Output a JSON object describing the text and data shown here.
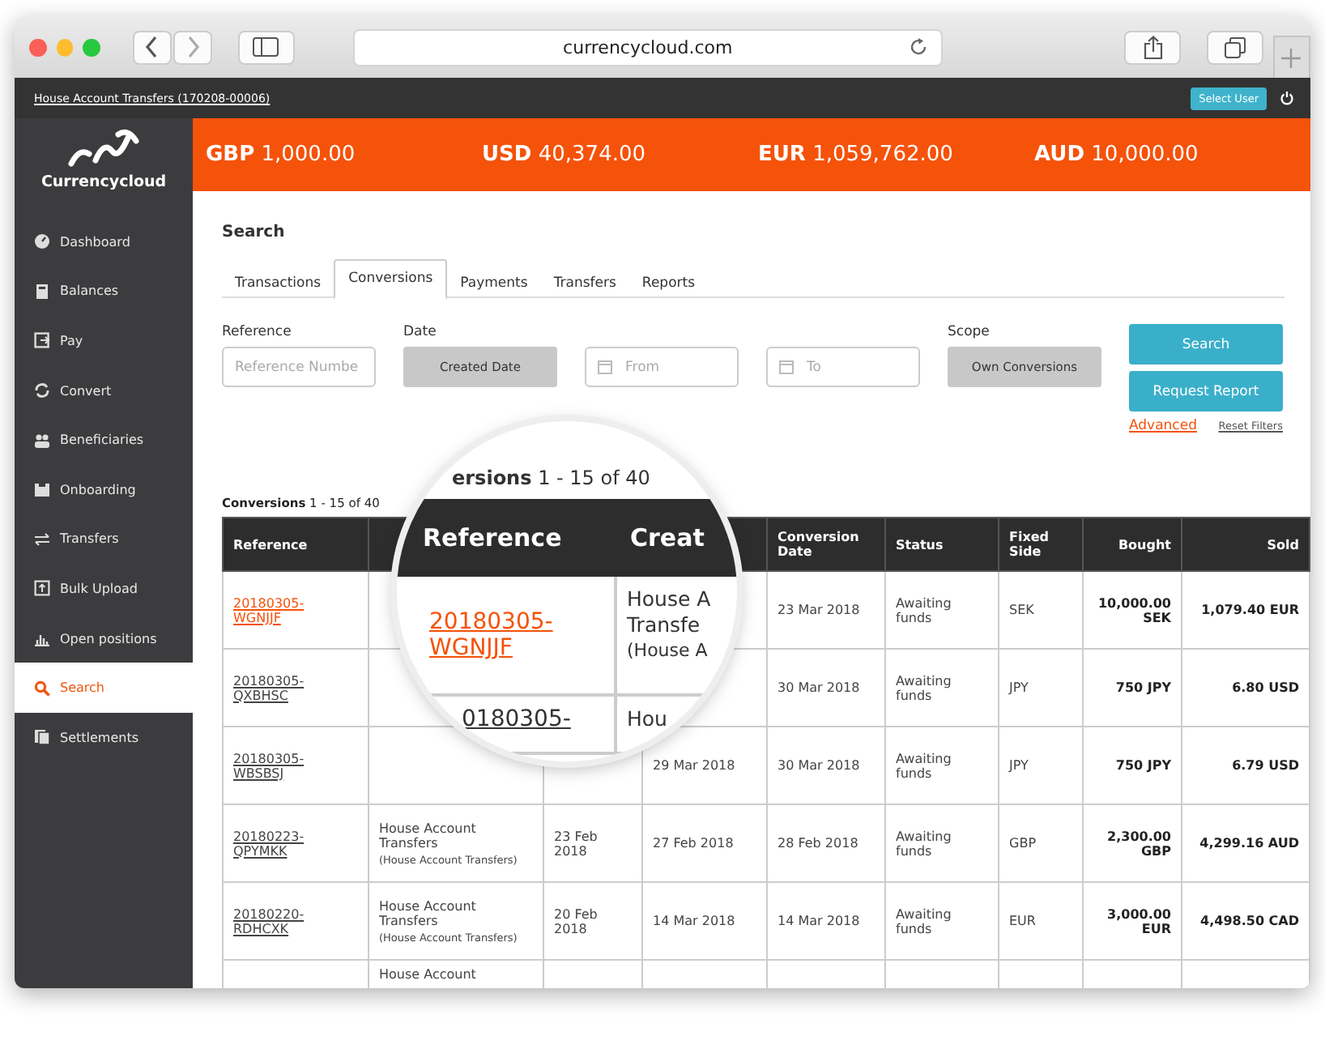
{
  "browser": {
    "url": "currencycloud.com"
  },
  "account_bar": {
    "account": "House Account Transfers (170208-00006)",
    "button": "Select User"
  },
  "balances": [
    {
      "currency": "GBP",
      "amount": "1,000.00"
    },
    {
      "currency": "USD",
      "amount": "40,374.00"
    },
    {
      "currency": "EUR",
      "amount": "1,059,762.00"
    },
    {
      "currency": "AUD",
      "amount": "10,000.00"
    }
  ],
  "sidebar": {
    "brand": "Currencycloud",
    "items": [
      {
        "label": "Dashboard",
        "selected": false
      },
      {
        "label": "Balances",
        "selected": false
      },
      {
        "label": "Pay",
        "selected": false
      },
      {
        "label": "Convert",
        "selected": false
      },
      {
        "label": "Beneficiaries",
        "selected": false
      },
      {
        "label": "Onboarding",
        "selected": false
      },
      {
        "label": "Transfers",
        "selected": false
      },
      {
        "label": "Bulk Upload",
        "selected": false
      },
      {
        "label": "Open positions",
        "selected": false
      },
      {
        "label": "Search",
        "selected": true
      },
      {
        "label": "Settlements",
        "selected": false
      }
    ]
  },
  "search": {
    "title": "Search",
    "tabs": [
      {
        "label": "Transactions",
        "selected": false
      },
      {
        "label": "Conversions",
        "selected": true
      },
      {
        "label": "Payments",
        "selected": false
      },
      {
        "label": "Transfers",
        "selected": false
      },
      {
        "label": "Reports",
        "selected": false
      }
    ],
    "reference_label": "Reference",
    "reference_placeholder": "Reference Numbe",
    "date_label": "Date",
    "date_type": "Created Date",
    "from_placeholder": "From",
    "to_placeholder": "To",
    "scope_label": "Scope",
    "scope": "Own Conversions",
    "search_button": "Search",
    "report_button": "Request Report",
    "advanced_link": "Advanced",
    "reset_link": "Reset Filters"
  },
  "table": {
    "caption_bold": "Conversions",
    "caption_rest": "1 - 15 of 40",
    "columns": [
      {
        "label": "Reference"
      },
      {},
      {},
      {},
      {
        "label": "Conversion Date"
      },
      {
        "label": "Status"
      },
      {
        "label": "Fixed Side"
      },
      {
        "label": "Bought"
      },
      {
        "label": "Sold"
      }
    ],
    "rows": [
      {
        "reference": "20180305-WGNJJF",
        "highlighted": true,
        "conversion_date": "23 Mar 2018",
        "status": "Awaiting funds",
        "fixed_side": "SEK",
        "bought": "10,000.00 SEK",
        "sold": "1,079.40 EUR"
      },
      {
        "reference": "20180305-QXBHSC",
        "highlighted": false,
        "conversion_date": "30 Mar 2018",
        "status": "Awaiting funds",
        "fixed_side": "JPY",
        "bought": "750 JPY",
        "sold": "6.80 USD"
      },
      {
        "reference": "20180305-WBSBSJ",
        "highlighted": false,
        "column_4": "29 Mar 2018",
        "conversion_date": "30 Mar 2018",
        "status": "Awaiting funds",
        "fixed_side": "JPY",
        "bought": "750 JPY",
        "sold": "6.79 USD"
      },
      {
        "reference": "20180223-QPYMKK",
        "highlighted": false,
        "created_by": "House Account Transfers",
        "created_by_sub": "(House Account Transfers)",
        "created_date": "23 Feb 2018",
        "column_4": "27 Feb 2018",
        "conversion_date": "28 Feb 2018",
        "status": "Awaiting funds",
        "fixed_side": "GBP",
        "bought": "2,300.00 GBP",
        "sold": "4,299.16 AUD"
      },
      {
        "reference": "20180220-RDHCXK",
        "highlighted": false,
        "created_by": "House Account Transfers",
        "created_by_sub": "(House Account Transfers)",
        "created_date": "20 Feb 2018",
        "column_4": "14 Mar 2018",
        "conversion_date": "14 Mar 2018",
        "status": "Awaiting funds",
        "fixed_side": "EUR",
        "bought": "3,000.00 EUR",
        "sold": "4,498.50 CAD"
      },
      {
        "created_by": "House Account"
      }
    ]
  },
  "magnifier": {
    "caption_bold": "ersions",
    "caption_rest": "1 - 15 of 40",
    "columns": [
      "Reference",
      "Creat"
    ],
    "rows": [
      {
        "reference": "20180305-WGNJJF",
        "highlighted": true,
        "created_by": "House A Transfe",
        "created_by_sub": "(House A"
      },
      {
        "reference": "0180305-",
        "highlighted": false,
        "created_by": "Hou"
      }
    ]
  }
}
